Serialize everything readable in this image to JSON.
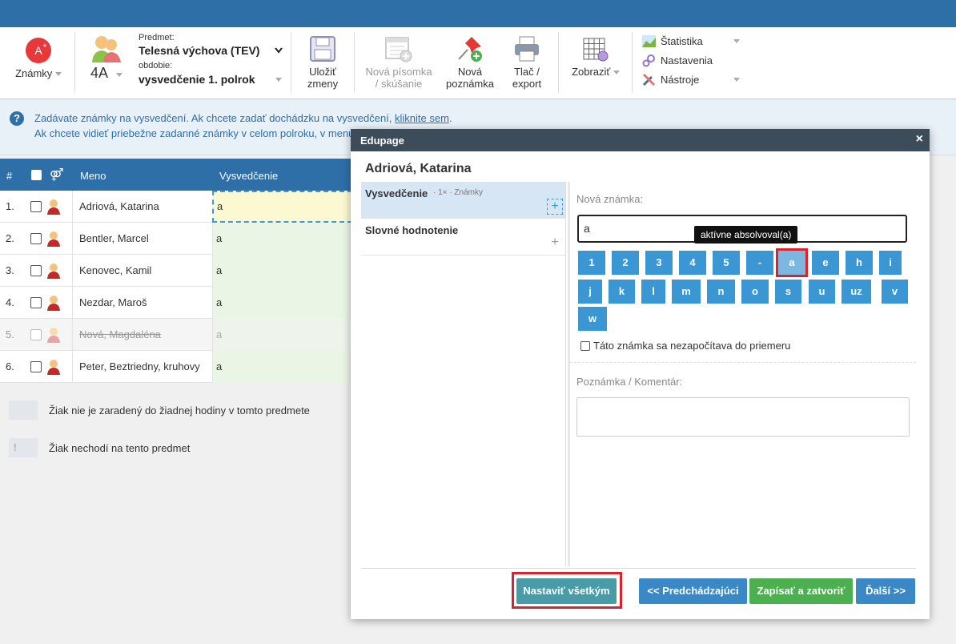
{
  "toolbar": {
    "znamky_label": "Známky",
    "class_label": "4A",
    "subject_caption": "Predmet:",
    "subject_value": "Telesná výchova (TEV)",
    "period_caption": "obdobie:",
    "period_value": "vysvedčenie 1. polrok",
    "save_line1": "Uložiť",
    "save_line2": "zmeny",
    "new_test_line1": "Nová písomka",
    "new_test_line2": "/ skúšanie",
    "new_note_line1": "Nová",
    "new_note_line2": "poznámka",
    "print_line1": "Tlač /",
    "print_line2": "export",
    "show_label": "Zobraziť",
    "statistics_label": "Štatistika",
    "settings_label": "Nastavenia",
    "tools_label": "Nástroje"
  },
  "info": {
    "line1_text": "Zadávate známky na vysvedčení. Ak chcete zadať dochádzku na vysvedčení, ",
    "line1_link": "kliknite sem",
    "line1_end": ".",
    "line2_text": "Ak chcete vidieť priebežne zadanné známky v celom polroku, v menu"
  },
  "grid": {
    "col_num": "#",
    "col_name": "Meno",
    "col_vys": "Vysvedčenie",
    "rows": [
      {
        "num": "1.",
        "name": "Adriová, Katarina",
        "grade": "a"
      },
      {
        "num": "2.",
        "name": "Bentler, Marcel",
        "grade": "a"
      },
      {
        "num": "3.",
        "name": "Kenovec, Kamil",
        "grade": "a"
      },
      {
        "num": "4.",
        "name": "Nezdar, Maroš",
        "grade": "a"
      },
      {
        "num": "5.",
        "name": "Nová, Magdaléna",
        "grade": "a"
      },
      {
        "num": "6.",
        "name": "Peter, Beztriedny, kruhovy",
        "grade": "a"
      }
    ]
  },
  "legend": {
    "item1": "Žiak nie je zaradený do žiadnej hodiny v tomto predmete",
    "item2_mark": "!",
    "item2": "Žiak nechodí na tento predmet"
  },
  "dialog": {
    "title": "Edupage",
    "close": "×",
    "student": "Adriová, Katarina",
    "left_items": [
      {
        "title": "Vysvedčenie",
        "sub": "· 1× · Známky"
      },
      {
        "title": "Slovné hodnotenie",
        "sub": ""
      }
    ],
    "new_grade_label": "Nová známka:",
    "grade_input_value": "a",
    "tooltip": "aktívne absolvoval(a)",
    "grade_buttons": [
      "1",
      "2",
      "3",
      "4",
      "5",
      "-",
      "a",
      "e",
      "h",
      "i",
      "j",
      "k",
      "l",
      "m",
      "n",
      "o",
      "s",
      "u",
      "uz",
      "v",
      "w"
    ],
    "exclude_checkbox": "Táto známka sa nezapočítava do priemeru",
    "comment_label": "Poznámka / Komentár:",
    "btn_set_all": "Nastaviť všetkým",
    "btn_prev": "<< Predchádzajúci",
    "btn_save_close": "Zapísať a zatvoriť",
    "btn_next": "Ďalší >>"
  },
  "colors": {
    "header_blue": "#2f6fa8",
    "grade_button": "#3a97d4",
    "highlight_red": "#d9232e",
    "save_green": "#4caf50"
  }
}
